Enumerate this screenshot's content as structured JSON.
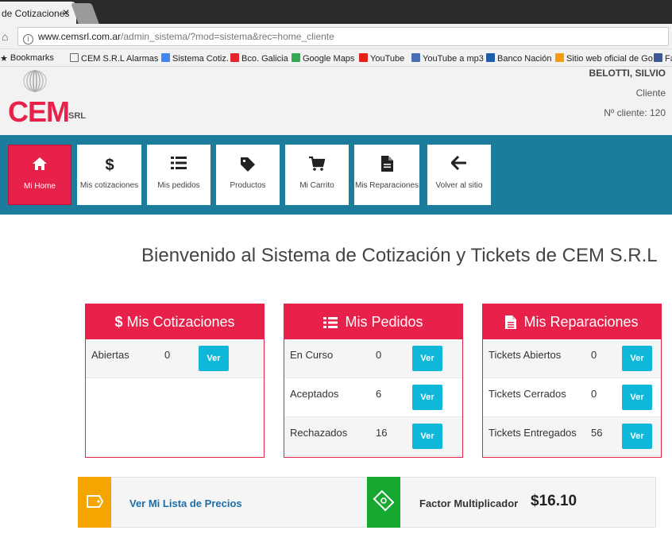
{
  "browser": {
    "tab_title": "de Cotizaciones",
    "tab_close": "✕",
    "url_domain": "www.cemsrl.com.ar",
    "url_path": "/admin_sistema/?mod=sistema&rec=home_cliente",
    "bookmarks": [
      {
        "label": "Bookmarks",
        "icon": "star-icon",
        "color": "#333333"
      },
      {
        "label": "CEM S.R.L Alarmas -",
        "icon": "page-icon",
        "color": "#666666"
      },
      {
        "label": "Sistema Cotiz.",
        "icon": "google-icon",
        "color": "#4285f4"
      },
      {
        "label": "Bco. Galicia",
        "icon": "galicia-icon",
        "color": "#e3262b"
      },
      {
        "label": "Google Maps",
        "icon": "maps-icon",
        "color": "#34a853"
      },
      {
        "label": "YouTube",
        "icon": "youtube-icon",
        "color": "#e62117"
      },
      {
        "label": "YouTube a mp3",
        "icon": "mp3-icon",
        "color": "#4a6fb5"
      },
      {
        "label": "Banco Nación",
        "icon": "bank-icon",
        "color": "#1f5fa8"
      },
      {
        "label": "Sitio web oficial de Go",
        "icon": "site-icon",
        "color": "#f39c12"
      },
      {
        "label": "Fa",
        "icon": "facebook-icon",
        "color": "#3b5998"
      }
    ]
  },
  "header": {
    "logo_text": "CEM",
    "logo_suffix": "SRL",
    "user_name": "BELOTTI, SILVIO",
    "user_role": "Cliente",
    "client_number": "Nº cliente: 120"
  },
  "nav": [
    {
      "label": "Mi Home",
      "icon": "home-icon",
      "active": true
    },
    {
      "label": "Mis cotizaciones",
      "icon": "dollar-icon"
    },
    {
      "label": "Mis pedidos",
      "icon": "list-icon"
    },
    {
      "label": "Productos",
      "icon": "tag-icon"
    },
    {
      "label": "Mi Carrito",
      "icon": "cart-icon"
    },
    {
      "label": "Mis Reparaciones",
      "icon": "file-icon"
    },
    {
      "label": "Volver al sitio",
      "icon": "arrow-left-icon"
    }
  ],
  "welcome": "Bienvenido al Sistema de Cotización y Tickets de CEM S.R.L",
  "cards": {
    "cotizaciones": {
      "title": "Mis Cotizaciones",
      "icon_glyph": "$",
      "rows": [
        {
          "label": "Abiertas",
          "value": "0",
          "button": "Ver"
        }
      ]
    },
    "pedidos": {
      "title": "Mis Pedidos",
      "rows": [
        {
          "label": "En Curso",
          "value": "0",
          "button": "Ver"
        },
        {
          "label": "Aceptados",
          "value": "6",
          "button": "Ver"
        },
        {
          "label": "Rechazados",
          "value": "16",
          "button": "Ver"
        }
      ]
    },
    "reparaciones": {
      "title": "Mis Reparaciones",
      "rows": [
        {
          "label": "Tickets Abiertos",
          "value": "0",
          "button": "Ver"
        },
        {
          "label": "Tickets Cerrados",
          "value": "0",
          "button": "Ver"
        },
        {
          "label": "Tickets Entregados",
          "value": "56",
          "button": "Ver"
        }
      ]
    }
  },
  "bottom": {
    "price_list_link": "Ver Mi Lista de Precios",
    "factor_label": "Factor Multiplicador",
    "factor_value": "$16.10"
  },
  "colors": {
    "accent": "#e8214a",
    "nav_bg": "#1b7d9b",
    "button": "#0fb8d9",
    "price_icon_bg": "#f5a500",
    "factor_icon_bg": "#16a831"
  }
}
